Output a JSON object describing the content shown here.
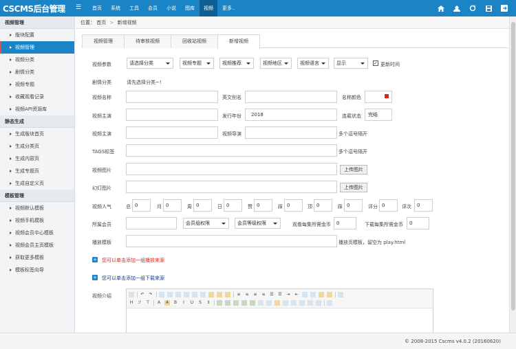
{
  "app": {
    "logo": "CSCMS后台管理",
    "menu_toggle": "☰"
  },
  "topnav": [
    {
      "label": "首页",
      "active": false
    },
    {
      "label": "系统",
      "active": false
    },
    {
      "label": "工具",
      "active": false
    },
    {
      "label": "会员",
      "active": false
    },
    {
      "label": "小说",
      "active": false
    },
    {
      "label": "图库",
      "active": false
    },
    {
      "label": "视频",
      "active": true
    },
    {
      "label": "更多..",
      "active": false
    }
  ],
  "topicons": [
    "home-icon",
    "user-icon",
    "refresh-icon",
    "save-icon",
    "logout-icon"
  ],
  "sidebar": {
    "group1": "视频管理",
    "items1": [
      "版块配置",
      "视频管理",
      "视频分类",
      "剧情分类",
      "视频专题",
      "收藏观看记录",
      "视频API资源库"
    ],
    "group2": "静态生成",
    "items2": [
      "生成版块首页",
      "生成分类页",
      "生成内容页",
      "生成专题页",
      "生成自定义页"
    ],
    "group3": "模板管理",
    "items3": [
      "视频默认模板",
      "视频手机模板",
      "视频会员中心模板",
      "视频会员主页模板",
      "获取更多模板",
      "模板标签向导"
    ]
  },
  "crumb": {
    "prefix": "位置：",
    "home": "首页",
    "sep": ">",
    "current": "新增视频"
  },
  "tabs": [
    "视频管理",
    "待审核视频",
    "回收站视频",
    "新增视频"
  ],
  "form": {
    "params_label": "视频参数",
    "cat_select": "请选择分类",
    "topic_select": "视频专题",
    "type_select": "视频推荐",
    "region_select": "视频地区",
    "lang_select": "视频语言",
    "show_select": "显示",
    "update_time": "更新时间",
    "update_checked": "✓",
    "plot_label": "剧情分类",
    "plot_hint": "请先选择分类~!",
    "name_label": "视频名称",
    "en_label": "英文别名",
    "color_label": "名称颜色",
    "actor_label": "视频主演",
    "year_label": "发行年份",
    "year_value": "2018",
    "status_label": "连载状态",
    "status_value": "完结",
    "director_label": "视频导演",
    "tags_note": "多个逗号隔开",
    "tag_label": "TAGS标签",
    "tag_note": "多个逗号隔开",
    "img_label": "视频图片",
    "upload1": "上传图片",
    "slide_label": "幻灯图片",
    "upload2": "上传图片",
    "pop_label": "视频人气",
    "pop_fields": [
      {
        "label": "总",
        "value": "0"
      },
      {
        "label": "月",
        "value": "0"
      },
      {
        "label": "周",
        "value": "0"
      },
      {
        "label": "日",
        "value": "0"
      },
      {
        "label": "赞",
        "value": "0"
      },
      {
        "label": "踩",
        "value": "0"
      },
      {
        "label": "顶",
        "value": "0"
      },
      {
        "label": "踩",
        "value": "0"
      }
    ],
    "score_label": "评分",
    "score_value": "0",
    "score_count_label": "评次",
    "score_count_value": "0",
    "member_label": "所属会员",
    "group_select": "会员组权限",
    "level_select": "会员等级权限",
    "watch_label": "观看每集所需金币",
    "watch_value": "0",
    "download_label": "下载每集所需金币",
    "download_value": "0",
    "tpl_label": "播放模板",
    "tpl_note": "播放页模板，留空为 play.html",
    "add_play": "您可以单击添加一组播放来源",
    "add_down": "您可以单击添加一组下载来源",
    "intro_label": "视频介绍"
  },
  "footer": "© 2008-2015  Cscms v4.0.2 (20160620)",
  "colors": {
    "accent": "#1a84c6",
    "active_dark": "#0e5f93",
    "red": "#d9261c"
  }
}
